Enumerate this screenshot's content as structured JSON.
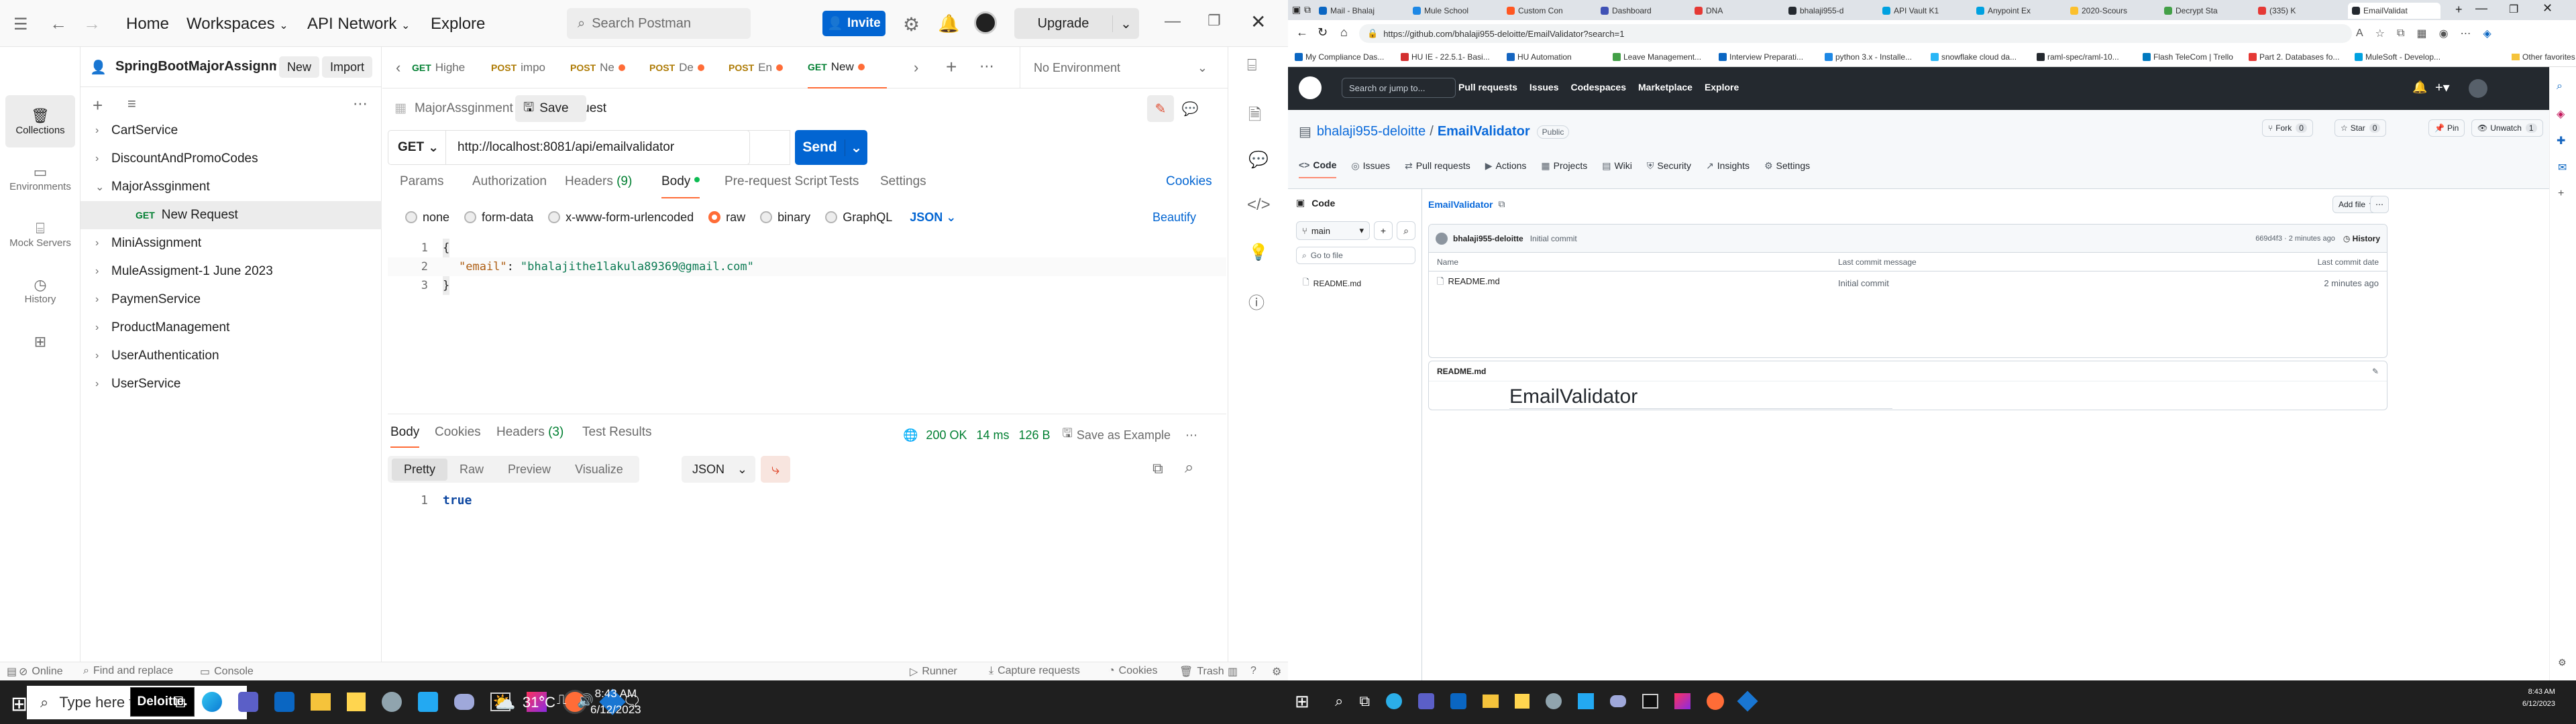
{
  "postman": {
    "topbar": {
      "home": "Home",
      "workspaces": "Workspaces",
      "api_network": "API Network",
      "explore": "Explore",
      "search_placeholder": "Search Postman",
      "invite": "Invite",
      "upgrade": "Upgrade"
    },
    "workspace_name": "SpringBootMajorAssignment(May...",
    "new_btn": "New",
    "import_btn": "Import",
    "rail": [
      "Collections",
      "Environments",
      "Mock Servers",
      "History"
    ],
    "collections": [
      "CartService",
      "DiscountAndPromoCodes",
      "MajorAssginment",
      "MiniAssignment",
      "MuleAssigment-1 June 2023",
      "PaymenService",
      "ProductManagement",
      "UserAuthentication",
      "UserService"
    ],
    "open_request": {
      "method": "GET",
      "name": "New Request"
    },
    "tabs": [
      {
        "method": "GET",
        "name": "Highe",
        "dot": false
      },
      {
        "method": "POST",
        "name": "impo",
        "dot": false
      },
      {
        "method": "POST",
        "name": "Ne",
        "dot": true
      },
      {
        "method": "POST",
        "name": "De",
        "dot": true
      },
      {
        "method": "POST",
        "name": "En",
        "dot": true
      },
      {
        "method": "GET",
        "name": "New",
        "dot": true
      }
    ],
    "environment": "No Environment",
    "breadcrumb": {
      "parent": "MajorAssginment",
      "sep": "/",
      "current": "New Request"
    },
    "save": "Save",
    "method": "GET",
    "url": "http://localhost:8081/api/emailvalidator",
    "send": "Send",
    "req_tabs": {
      "params": "Params",
      "authorization": "Authorization",
      "headers": "Headers",
      "headers_count": "(9)",
      "body": "Body",
      "prereq": "Pre-request Script",
      "tests": "Tests",
      "settings": "Settings",
      "cookies": "Cookies"
    },
    "body_types": {
      "none": "none",
      "form_data": "form-data",
      "urlencoded": "x-www-form-urlencoded",
      "raw": "raw",
      "binary": "binary",
      "graphql": "GraphQL",
      "format": "JSON",
      "beautify": "Beautify"
    },
    "body_lines": {
      "n1": "1",
      "n2": "2",
      "n3": "3",
      "l1": "{",
      "key": "\"email\"",
      "colon": ":",
      "value": "\"bhalajithe1lakula89369@gmail.com\"",
      "l3": "}"
    },
    "response": {
      "tabs": {
        "body": "Body",
        "cookies": "Cookies",
        "headers": "Headers",
        "headers_count": "(3)",
        "test_results": "Test Results"
      },
      "status": "200 OK",
      "time": "14 ms",
      "size": "126 B",
      "save_example": "Save as Example",
      "views": {
        "pretty": "Pretty",
        "raw": "Raw",
        "preview": "Preview",
        "visualize": "Visualize",
        "format": "JSON"
      },
      "line_no": "1",
      "value": "true"
    },
    "statusbar": {
      "online": "Online",
      "find": "Find and replace",
      "console": "Console",
      "runner": "Runner",
      "capture": "Capture requests",
      "cookies": "Cookies",
      "trash": "Trash"
    }
  },
  "taskbar": {
    "search_placeholder": "Type here to search",
    "deloitte": "Deloitte.",
    "weather": "31°C",
    "time": "8:43 AM",
    "date": "6/12/2023",
    "time_small": "8:43 AM",
    "date_small": "6/12/2023"
  },
  "browser": {
    "tabs": [
      "Mail - Bhalaj",
      "Mule School",
      "Custom Con",
      "Dashboard",
      "DNA",
      "bhalaji955-d",
      "API Vault K1",
      "Anypoint Ex",
      "2020-Scours",
      "Decrypt Sta",
      "(335) K",
      "EmailValidat"
    ],
    "tab_colors": [
      "#0a66c2",
      "#1e88e5",
      "#ff5722",
      "#3f51b5",
      "#e53935",
      "#24292f",
      "#00a1e0",
      "#00a1e0",
      "#fbc02d",
      "#43a047",
      "#e53935",
      "#24292f"
    ],
    "url": "https://github.com/bhalaji955-deloitte/EmailValidator?search=1",
    "bookmarks": [
      "My Compliance Das...",
      "HU IE - 22.5.1- Basi...",
      "HU Automation",
      "Leave Management...",
      "Interview Preparati...",
      "python 3.x - Installe...",
      "snowflake cloud da...",
      "raml-spec/raml-10...",
      "Flash TeleCom | Trello",
      "Part 2. Databases fo...",
      "MuleSoft - Develop..."
    ],
    "other_favorites": "Other favorites"
  },
  "github": {
    "search_placeholder": "Search or jump to...",
    "nav": [
      "Pull requests",
      "Issues",
      "Codespaces",
      "Marketplace",
      "Explore"
    ],
    "owner": "bhalaji955-deloitte",
    "repo_sep": "/",
    "repo": "EmailValidator",
    "visibility": "Public",
    "pin": "Pin",
    "unwatch": "Unwatch",
    "unwatch_count": "1",
    "fork": "Fork",
    "fork_count": "0",
    "star": "Star",
    "star_count": "0",
    "repo_tabs": [
      "Code",
      "Issues",
      "Pull requests",
      "Actions",
      "Projects",
      "Wiki",
      "Security",
      "Insights",
      "Settings"
    ],
    "tree_title": "Code",
    "branch": "main",
    "go_to_file": "Go to file",
    "tree_files": [
      "README.md"
    ],
    "breadcrumb_repo": "EmailValidator",
    "add_file": "Add file",
    "commit_author": "bhalaji955-deloitte",
    "commit_msg": "Initial commit",
    "commit_meta": "669d4f3 · 2 minutes ago",
    "history": "History",
    "table_headers": {
      "name": "Name",
      "last_msg": "Last commit message",
      "last_date": "Last commit date"
    },
    "files": [
      {
        "name": "README.md",
        "msg": "Initial commit",
        "date": "2 minutes ago"
      }
    ],
    "readme_label": "README.md",
    "readme_heading": "EmailValidator"
  }
}
